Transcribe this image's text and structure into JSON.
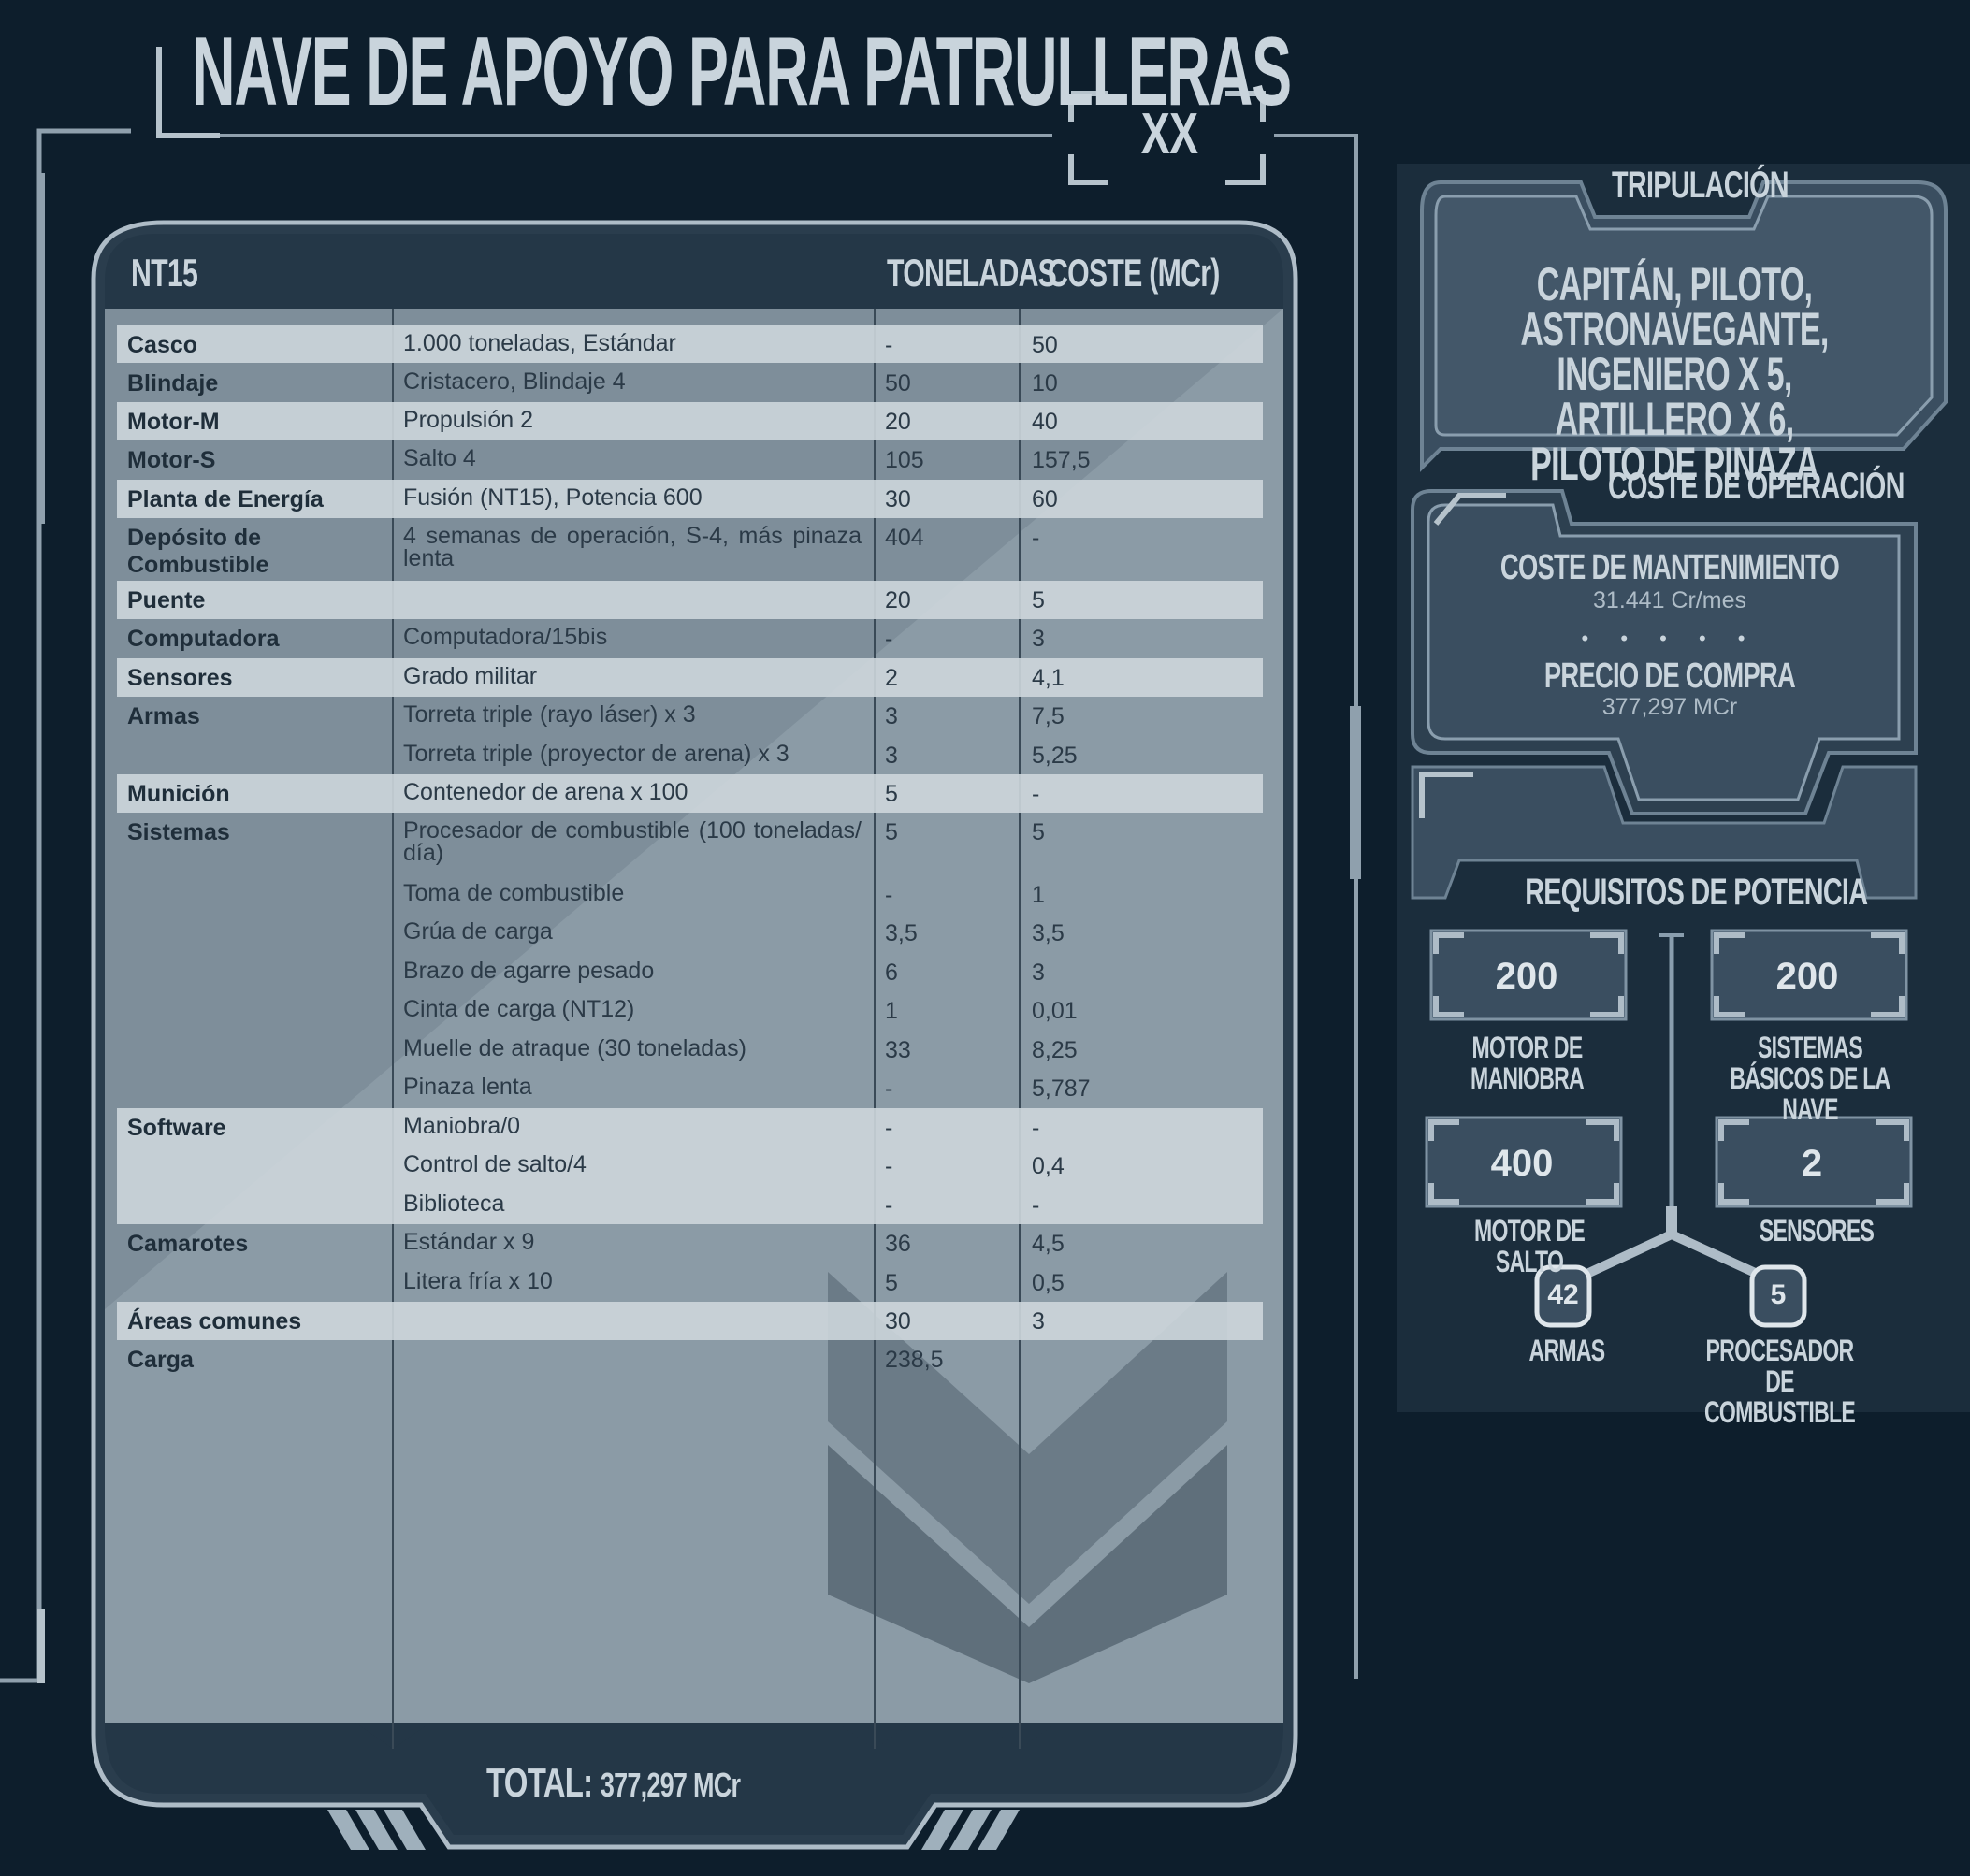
{
  "title": "NAVE DE APOYO PARA PATRULLERAS",
  "volume": "XX",
  "table": {
    "header": {
      "nt": "NT15",
      "col_tons": "TONELADAS",
      "col_cost": "COSTE (MCr)"
    },
    "rows": [
      {
        "item": "Casco",
        "desc": "1.000 toneladas, Estándar",
        "tons": "-",
        "cost": "50"
      },
      {
        "item": "Blindaje",
        "desc": "Cristacero, Blindaje 4",
        "tons": "50",
        "cost": "10"
      },
      {
        "item": "Motor-M",
        "desc": "Propulsión 2",
        "tons": "20",
        "cost": "40"
      },
      {
        "item": "Motor-S",
        "desc": "Salto 4",
        "tons": "105",
        "cost": "157,5"
      },
      {
        "item": "Planta de Energía",
        "desc": "Fusión (NT15), Potencia 600",
        "tons": "30",
        "cost": "60"
      },
      {
        "item": "Depósito de Combustible",
        "desc": "4 semanas de operación, S-4, más pinaza lenta",
        "tons": "404",
        "cost": "-"
      },
      {
        "item": "Puente",
        "desc": "",
        "tons": "20",
        "cost": "5"
      },
      {
        "item": "Computadora",
        "desc": "Computadora/15bis",
        "tons": "-",
        "cost": "3"
      },
      {
        "item": "Sensores",
        "desc": "Grado militar",
        "tons": "2",
        "cost": "4,1"
      },
      {
        "item": "Armas",
        "desc": "Torreta triple (rayo láser) x 3",
        "tons": "3",
        "cost": "7,5"
      },
      {
        "item": "",
        "desc": "Torreta triple (proyector de arena) x 3",
        "tons": "3",
        "cost": "5,25"
      },
      {
        "item": "Munición",
        "desc": "Contenedor de arena x 100",
        "tons": "5",
        "cost": "-"
      },
      {
        "item": "Sistemas",
        "desc": "Procesador de combustible (100 toneladas/ día)",
        "tons": "5",
        "cost": "5"
      },
      {
        "item": "",
        "desc": "Toma de combustible",
        "tons": "-",
        "cost": "1"
      },
      {
        "item": "",
        "desc": "Grúa de carga",
        "tons": "3,5",
        "cost": "3,5"
      },
      {
        "item": "",
        "desc": "Brazo de agarre pesado",
        "tons": "6",
        "cost": "3"
      },
      {
        "item": "",
        "desc": "Cinta de carga (NT12)",
        "tons": "1",
        "cost": "0,01"
      },
      {
        "item": "",
        "desc": "Muelle de atraque (30 toneladas)",
        "tons": "33",
        "cost": "8,25"
      },
      {
        "item": "",
        "desc": "Pinaza lenta",
        "tons": "-",
        "cost": "5,787"
      },
      {
        "item": "Software",
        "desc": "Maniobra/0",
        "tons": "-",
        "cost": "-"
      },
      {
        "item": "",
        "desc": "Control de salto/4",
        "tons": "-",
        "cost": "0,4"
      },
      {
        "item": "",
        "desc": "Biblioteca",
        "tons": "-",
        "cost": "-"
      },
      {
        "item": "Camarotes",
        "desc": "Estándar x 9",
        "tons": "36",
        "cost": "4,5"
      },
      {
        "item": "",
        "desc": "Litera fría x 10",
        "tons": "5",
        "cost": "0,5"
      },
      {
        "item": "Áreas comunes",
        "desc": "",
        "tons": "30",
        "cost": "3"
      },
      {
        "item": "Carga",
        "desc": "",
        "tons": "238,5",
        "cost": ""
      }
    ],
    "total_label": "TOTAL:",
    "total_value": "377,297 MCr"
  },
  "crew": {
    "title": "TRIPULACIÓN",
    "text": "CAPITÁN, PILOTO, ASTRONAVEGANTE, INGENIERO X 5, ARTILLERO X 6, PILOTO DE PINAZA"
  },
  "operation": {
    "title": "COSTE DE OPERACIÓN",
    "maintenance_label": "COSTE DE MANTENIMIENTO",
    "maintenance_value": "31.441 Cr/mes",
    "separator": "• • • • •",
    "purchase_label": "PRECIO DE COMPRA",
    "purchase_value": "377,297 MCr"
  },
  "power": {
    "title": "REQUISITOS DE POTENCIA",
    "maneuver": {
      "value": "200",
      "label": "MOTOR DE MANIOBRA"
    },
    "basic": {
      "value": "200",
      "label": "SISTEMAS BÁSICOS DE LA NAVE"
    },
    "jump": {
      "value": "400",
      "label": "MOTOR DE SALTO"
    },
    "sensors": {
      "value": "2",
      "label": "SENSORES"
    },
    "weapons": {
      "value": "42",
      "label": "ARMAS"
    },
    "fuel_processor": {
      "value": "5",
      "label": "PROCESADOR DE COMBUSTIBLE"
    }
  }
}
